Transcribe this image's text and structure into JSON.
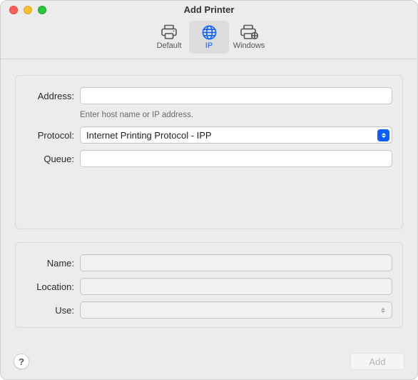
{
  "window": {
    "title": "Add Printer"
  },
  "tabs": {
    "default": "Default",
    "ip": "IP",
    "windows": "Windows",
    "active": "ip"
  },
  "top": {
    "address": {
      "label": "Address:",
      "value": "",
      "hint": "Enter host name or IP address."
    },
    "protocol": {
      "label": "Protocol:",
      "selected": "Internet Printing Protocol - IPP"
    },
    "queue": {
      "label": "Queue:",
      "value": ""
    }
  },
  "bottom": {
    "name": {
      "label": "Name:",
      "value": ""
    },
    "location": {
      "label": "Location:",
      "value": ""
    },
    "use": {
      "label": "Use:",
      "selected": ""
    }
  },
  "footer": {
    "help": "?",
    "add": "Add"
  }
}
